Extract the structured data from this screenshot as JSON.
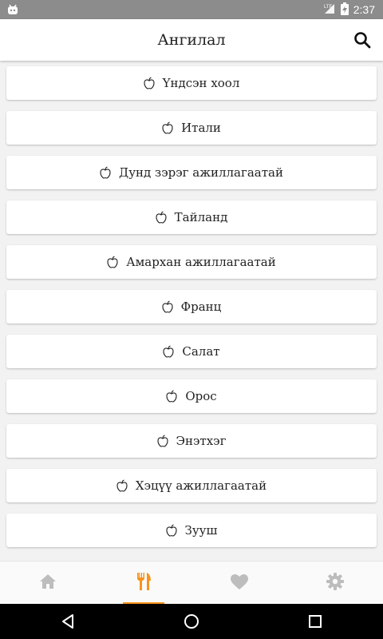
{
  "status_bar": {
    "time": "2:37",
    "network_icon": "network-lte-icon",
    "battery_icon": "battery-charging-icon"
  },
  "app_bar": {
    "title": "Ангилал",
    "search_icon": "search-icon"
  },
  "categories": [
    {
      "label": "Үндсэн хоол",
      "icon": "apple-icon"
    },
    {
      "label": "Итали",
      "icon": "apple-icon"
    },
    {
      "label": "Дунд зэрэг ажиллагаатай",
      "icon": "apple-icon"
    },
    {
      "label": "Тайланд",
      "icon": "apple-icon"
    },
    {
      "label": "Амархан ажиллагаатай",
      "icon": "apple-icon"
    },
    {
      "label": "Франц",
      "icon": "apple-icon"
    },
    {
      "label": "Салат",
      "icon": "apple-icon"
    },
    {
      "label": "Орос",
      "icon": "apple-icon"
    },
    {
      "label": "Энэтхэг",
      "icon": "apple-icon"
    },
    {
      "label": "Хэцүү ажиллагаатай",
      "icon": "apple-icon"
    },
    {
      "label": "Зууш",
      "icon": "apple-icon"
    }
  ],
  "bottom_nav": {
    "items": [
      {
        "name": "home",
        "icon": "home-icon",
        "active": false
      },
      {
        "name": "categories",
        "icon": "fork-knife-icon",
        "active": true
      },
      {
        "name": "favorites",
        "icon": "heart-icon",
        "active": false
      },
      {
        "name": "settings",
        "icon": "gear-icon",
        "active": false
      }
    ],
    "active_color": "#f7941d",
    "inactive_color": "#bdbdbd"
  },
  "system_nav": [
    "back-icon",
    "home-circle-icon",
    "recents-icon"
  ]
}
